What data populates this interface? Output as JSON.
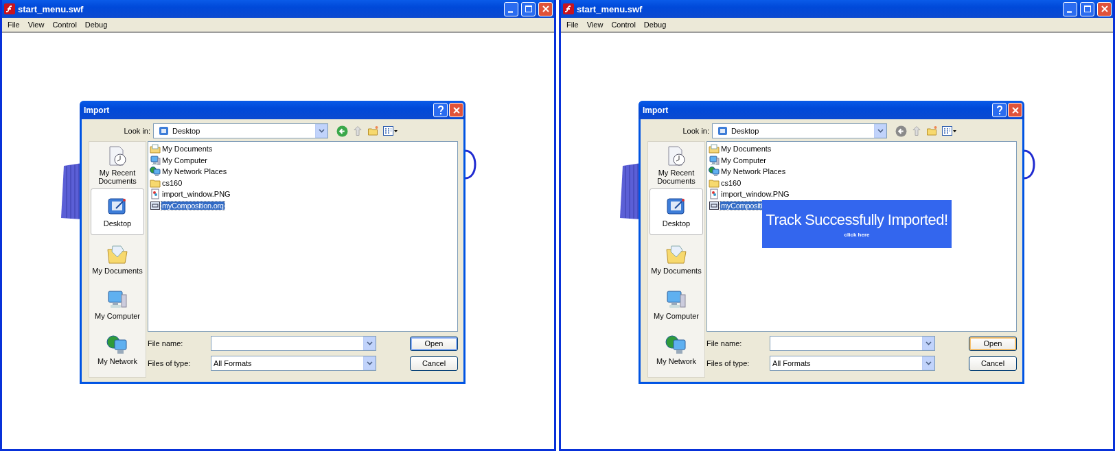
{
  "windows": [
    {
      "title": "start_menu.swf",
      "menu": [
        "File",
        "View",
        "Control",
        "Debug"
      ],
      "dialog": {
        "title": "Import",
        "look_in_label": "Look in:",
        "look_in_value": "Desktop",
        "back_disabled": false,
        "places": [
          {
            "label": "My Recent Documents",
            "kind": "recent",
            "selected": false
          },
          {
            "label": "Desktop",
            "kind": "desktop",
            "selected": true
          },
          {
            "label": "My Documents",
            "kind": "documents",
            "selected": false
          },
          {
            "label": "My Computer",
            "kind": "computer",
            "selected": false
          },
          {
            "label": "My Network",
            "kind": "network",
            "selected": false
          }
        ],
        "files": [
          {
            "name": "My Documents",
            "kind": "documents",
            "selected": false
          },
          {
            "name": "My Computer",
            "kind": "computer",
            "selected": false
          },
          {
            "name": "My Network Places",
            "kind": "network",
            "selected": false
          },
          {
            "name": "cs160",
            "kind": "folder",
            "selected": false
          },
          {
            "name": "import_window.PNG",
            "kind": "image",
            "selected": false
          },
          {
            "name": "myComposition.orq",
            "kind": "file",
            "selected": true
          }
        ],
        "file_name_label": "File name:",
        "files_of_type_label": "Files of type:",
        "files_of_type_value": "All Formats",
        "open_button": {
          "label": "Open",
          "hovered": false
        },
        "cancel_button": {
          "label": "Cancel"
        }
      }
    },
    {
      "title": "start_menu.swf",
      "menu": [
        "File",
        "View",
        "Control",
        "Debug"
      ],
      "dialog": {
        "title": "Import",
        "look_in_label": "Look in:",
        "look_in_value": "Desktop",
        "back_disabled": true,
        "places": [
          {
            "label": "My Recent Documents",
            "kind": "recent",
            "selected": false
          },
          {
            "label": "Desktop",
            "kind": "desktop",
            "selected": true
          },
          {
            "label": "My Documents",
            "kind": "documents",
            "selected": false
          },
          {
            "label": "My Computer",
            "kind": "computer",
            "selected": false
          },
          {
            "label": "My Network",
            "kind": "network",
            "selected": false
          }
        ],
        "files": [
          {
            "name": "My Documents",
            "kind": "documents",
            "selected": false
          },
          {
            "name": "My Computer",
            "kind": "computer",
            "selected": false
          },
          {
            "name": "My Network Places",
            "kind": "network",
            "selected": false
          },
          {
            "name": "cs160",
            "kind": "folder",
            "selected": false
          },
          {
            "name": "import_window.PNG",
            "kind": "image",
            "selected": false
          },
          {
            "name": "myCompositi",
            "kind": "file",
            "selected": true
          }
        ],
        "notification": {
          "title": "Track Successfully Imported!",
          "link": "click here"
        },
        "file_name_label": "File name:",
        "files_of_type_label": "Files of type:",
        "files_of_type_value": "All Formats",
        "open_button": {
          "label": "Open",
          "hovered": true
        },
        "cancel_button": {
          "label": "Cancel"
        }
      }
    }
  ]
}
